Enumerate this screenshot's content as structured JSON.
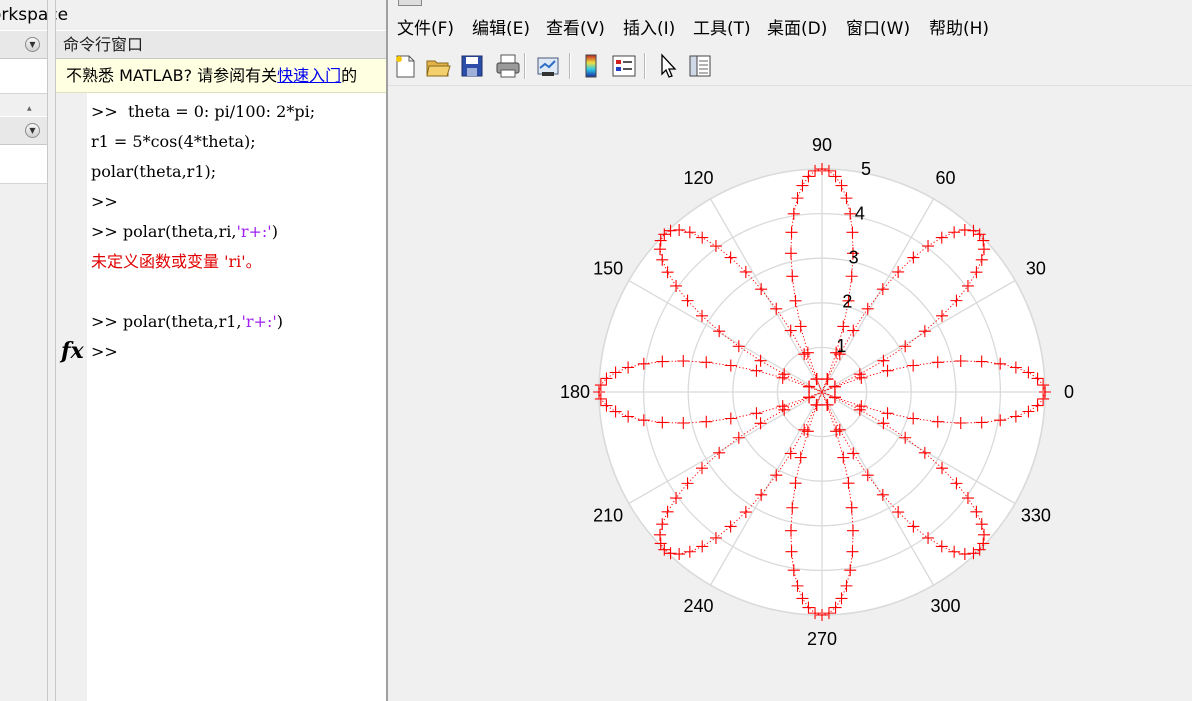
{
  "workspace": {
    "title": "orkspace"
  },
  "command_window": {
    "title": "命令行窗口",
    "banner_text": "不熟悉 MATLAB? 请参阅有关",
    "banner_link": "快速入门",
    "banner_suffix": "的",
    "fx_label": "fx",
    "lines": [
      {
        "prompt": ">>",
        "code": "  theta = 0: pi/100: 2*pi;"
      },
      {
        "prompt": "",
        "code": "r1 = 5*cos(4*theta);"
      },
      {
        "prompt": "",
        "code": "polar(theta,r1);"
      },
      {
        "prompt": ">>",
        "code": ""
      },
      {
        "prompt": ">>",
        "code": " polar(theta,ri,",
        "string": "'r+:'",
        "tail": ")"
      },
      {
        "error": "未定义函数或变量 'ri'。"
      },
      {
        "blank": true
      },
      {
        "prompt": ">>",
        "code": " polar(theta,r1,",
        "string": "'r+:'",
        "tail": ")"
      },
      {
        "prompt": ">>",
        "code": ""
      }
    ]
  },
  "figure": {
    "menu": [
      "文件(F)",
      "编辑(E)",
      "查看(V)",
      "插入(I)",
      "工具(T)",
      "桌面(D)",
      "窗口(W)",
      "帮助(H)"
    ],
    "toolbar": [
      "new-figure-icon",
      "open-file-icon",
      "save-icon",
      "print-icon",
      "link-plot-icon",
      "colorbar-icon",
      "legend-icon",
      "pointer-icon",
      "property-editor-icon"
    ]
  },
  "chart_data": {
    "type": "polar",
    "function": "r = 5*cos(4*theta)",
    "theta_range": [
      0,
      6.2832
    ],
    "theta_step": 0.031416,
    "rlim": [
      0,
      5
    ],
    "rticks": [
      "1",
      "2",
      "3",
      "4",
      "5"
    ],
    "angle_labels": [
      "0",
      "30",
      "60",
      "90",
      "120",
      "150",
      "180",
      "210",
      "240",
      "270",
      "300",
      "330"
    ],
    "line_color": "#ff0000",
    "marker": "+",
    "line_style": "dotted",
    "grid_color": "#dadada",
    "grid": true
  }
}
